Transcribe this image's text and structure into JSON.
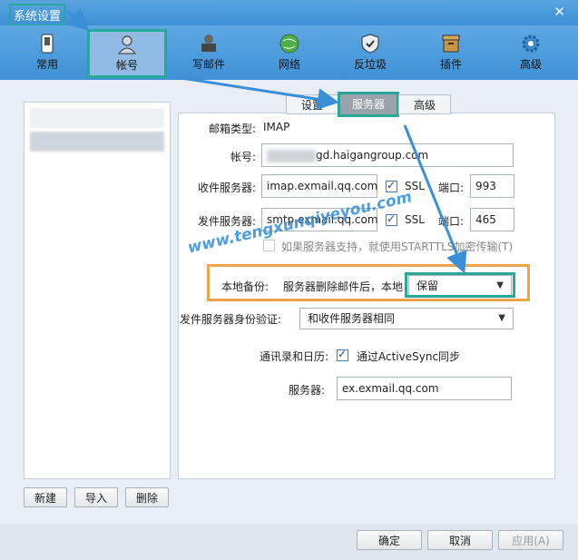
{
  "window": {
    "title": "系统设置",
    "close": "✕"
  },
  "toolbar": [
    {
      "label": "常用",
      "icon": "phone-icon"
    },
    {
      "label": "帐号",
      "icon": "user-icon"
    },
    {
      "label": "写邮件",
      "icon": "stamp-icon"
    },
    {
      "label": "网络",
      "icon": "globe-icon"
    },
    {
      "label": "反垃圾",
      "icon": "shield-icon"
    },
    {
      "label": "插件",
      "icon": "box-icon"
    },
    {
      "label": "高级",
      "icon": "gear-icon"
    }
  ],
  "tabs": [
    "设置",
    "服务器",
    "高级"
  ],
  "form": {
    "mailbox_type_label": "邮箱类型:",
    "mailbox_type_value": "IMAP",
    "account_label": "帐号:",
    "account_value": "gd.haigangroup.com",
    "incoming_label": "收件服务器:",
    "incoming_value": "imap.exmail.qq.com",
    "incoming_ssl": "SSL",
    "incoming_port_label": "端口:",
    "incoming_port": "993",
    "outgoing_label": "发件服务器:",
    "outgoing_value": "smtp.exmail.qq.com",
    "outgoing_ssl": "SSL",
    "outgoing_port_label": "端口:",
    "outgoing_port": "465",
    "starttls_text": "如果服务器支持，就使用STARTTLS加密传输(T)",
    "local_backup_label": "本地备份:",
    "local_backup_text": "服务器删除邮件后，本地",
    "local_backup_value": "保留",
    "auth_label": "发件服务器身份验证:",
    "auth_value": "和收件服务器相同",
    "contacts_label": "通讯录和日历:",
    "contacts_check": "通过ActiveSync同步",
    "server_label": "服务器:",
    "server_value": "ex.exmail.qq.com"
  },
  "left_buttons": [
    "新建",
    "导入",
    "删除"
  ],
  "footer": {
    "ok": "确定",
    "cancel": "取消",
    "apply": "应用(A)"
  },
  "watermark": "www.tengxunqiyeyou.com",
  "colors": {
    "title_bar": "#3c8fd4",
    "highlight_teal": "#2aa79b",
    "highlight_orange": "#f0a44a",
    "arrow_blue": "#3a8fd9"
  }
}
